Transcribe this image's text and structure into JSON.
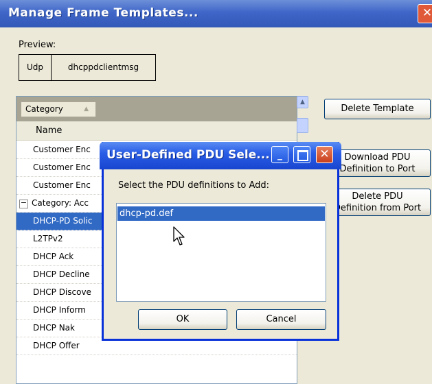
{
  "main_window": {
    "title": "Manage Frame Templates...",
    "close_glyph": "✕"
  },
  "preview": {
    "label": "Preview:",
    "cells": [
      "Udp",
      "dhcppdclientmsg"
    ]
  },
  "grid": {
    "group_chip": "Category",
    "sort_glyph": "▲",
    "column_header": "Name",
    "rows": [
      {
        "label": "Customer Enc",
        "type": "item"
      },
      {
        "label": "Customer Enc",
        "type": "item"
      },
      {
        "label": "Customer Enc",
        "type": "item"
      },
      {
        "label": "Category: Acc",
        "type": "category",
        "expand_glyph": "−"
      },
      {
        "label": "DHCP-PD Solic",
        "type": "item",
        "selected": true
      },
      {
        "label": "L2TPv2",
        "type": "item"
      },
      {
        "label": "DHCP Ack",
        "type": "item"
      },
      {
        "label": "DHCP Decline",
        "type": "item"
      },
      {
        "label": "DHCP Discove",
        "type": "item"
      },
      {
        "label": "DHCP Inform",
        "type": "item"
      },
      {
        "label": "DHCP Nak",
        "type": "item"
      },
      {
        "label": "DHCP Offer",
        "type": "item"
      }
    ],
    "scroll_up_glyph": "▲"
  },
  "side_buttons": {
    "delete_template": "Delete Template",
    "download_pdu_line1": "Download PDU",
    "download_pdu_line2": "Definition to Port",
    "delete_pdu_line1": "Delete PDU",
    "delete_pdu_line2": "Definition from Port"
  },
  "dialog": {
    "title": "User-Defined PDU Sele...",
    "minimize_glyph": "_",
    "close_glyph": "✕",
    "prompt": "Select the PDU definitions to Add:",
    "items": [
      "dhcp-pd.def"
    ],
    "ok_label": "OK",
    "cancel_label": "Cancel"
  },
  "colors": {
    "titlebar": "#3f66c8",
    "selection": "#316ac5",
    "window_bg": "#ece9d8"
  }
}
